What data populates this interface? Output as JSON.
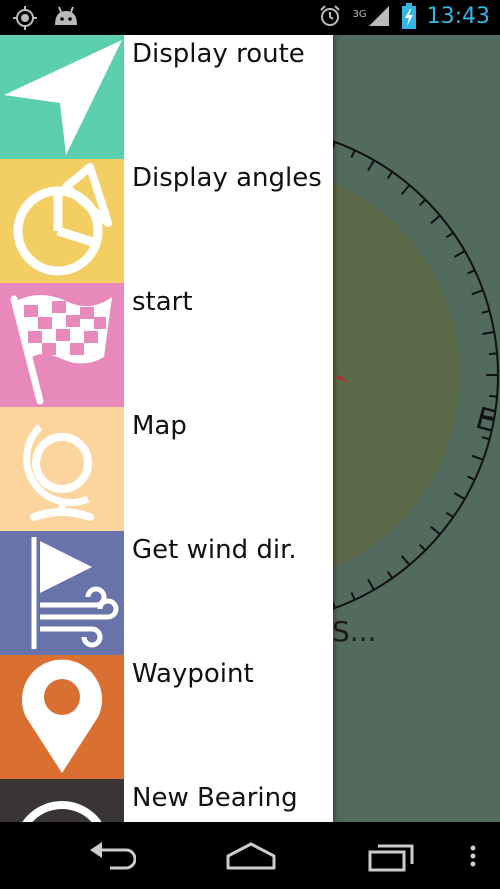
{
  "status_bar": {
    "time": "13:43",
    "network": "3G",
    "icons": [
      "gps-icon",
      "android-icon",
      "alarm-icon",
      "signal-icon",
      "battery-charging-icon"
    ]
  },
  "compass": {
    "heading_label": "E",
    "partial_text": "S..."
  },
  "drawer": {
    "items": [
      {
        "label": "Display route",
        "icon": "navigation-arrow-icon",
        "color": "#5ccfae"
      },
      {
        "label": "Display angles",
        "icon": "pie-chart-icon",
        "color": "#f3ce63"
      },
      {
        "label": "start",
        "icon": "checkered-flag-icon",
        "color": "#e889bb"
      },
      {
        "label": "Map",
        "icon": "globe-icon",
        "color": "#fbd59d"
      },
      {
        "label": "Get wind dir.",
        "icon": "wind-flag-icon",
        "color": "#6873aa"
      },
      {
        "label": "Waypoint",
        "icon": "map-pin-icon",
        "color": "#d97031"
      },
      {
        "label": "New Bearing",
        "icon": "compass-icon",
        "color": "#3a3535"
      }
    ]
  },
  "nav_bar": {
    "buttons": [
      "back-icon",
      "home-icon",
      "recents-icon",
      "overflow-menu-icon"
    ]
  }
}
